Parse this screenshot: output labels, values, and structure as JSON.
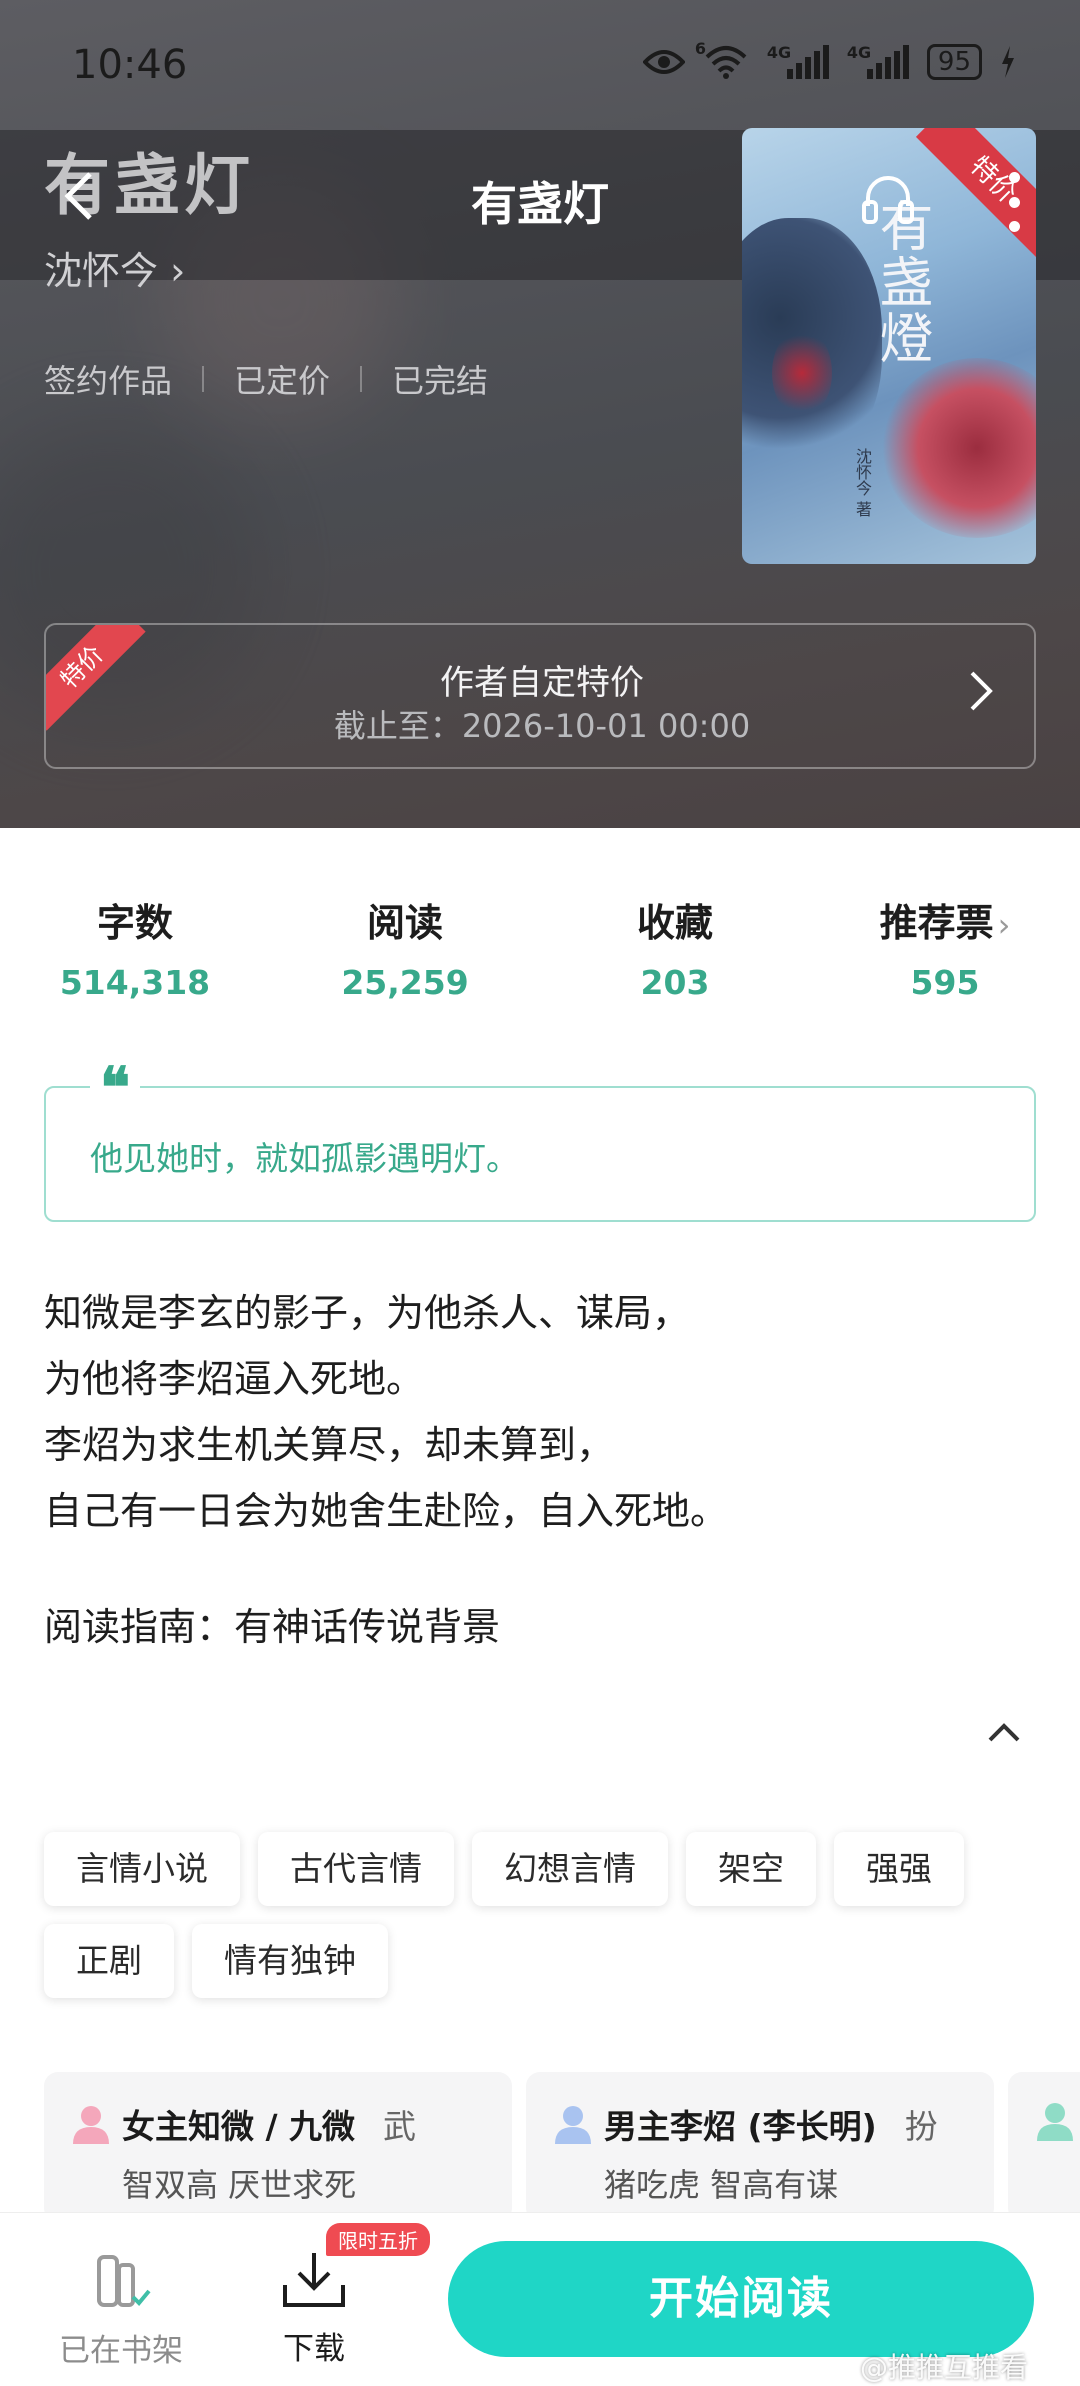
{
  "status_bar": {
    "time": "10:46",
    "signal1_label": "4G",
    "signal2_label": "4G",
    "wifi_label": "6",
    "battery": "95"
  },
  "header": {
    "background_title": "有盏灯",
    "nav_title": "有盏灯",
    "author": "沈怀今 ›"
  },
  "book_meta": {
    "items": [
      "签约作品",
      "已定价",
      "已完结"
    ]
  },
  "cover": {
    "ribbon": "特价",
    "title": "有盏燈",
    "author_mark": "沈怀今 著"
  },
  "promo": {
    "tag": "特价",
    "title": "作者自定特价",
    "deadline": "截止至：2026-10-01 00:00"
  },
  "stats": [
    {
      "label": "字数",
      "value": "514,318"
    },
    {
      "label": "阅读",
      "value": "25,259"
    },
    {
      "label": "收藏",
      "value": "203"
    },
    {
      "label": "推荐票",
      "value": "595"
    }
  ],
  "quote": {
    "mark": "“",
    "text": "他见她时，就如孤影遇明灯。"
  },
  "synopsis": {
    "lines": [
      "知微是李玄的影子，为他杀人、谋局，",
      "为他将李炤逼入死地。",
      "李炤为求生机关算尽，却未算到，",
      "自己有一日会为她舍生赴险，自入死地。"
    ],
    "guide": "阅读指南：有神话传说背景"
  },
  "tags": [
    "言情小说",
    "古代言情",
    "幻想言情",
    "架空",
    "强强",
    "正剧",
    "情有独钟"
  ],
  "characters": [
    {
      "name": "女主知微 / 九微",
      "extra": "武",
      "desc": "智双高 厌世求死",
      "icon_color": "#f4a7bb"
    },
    {
      "name": "男主李炤 (李长明)",
      "extra": "扮",
      "desc": "猪吃虎 智高有谋",
      "icon_color": "#a9c3f0"
    }
  ],
  "bottom_bar": {
    "shelf_label": "已在书架",
    "download_label": "下载",
    "download_badge": "限时五折",
    "read_button": "开始阅读"
  },
  "watermark": "@推推互推看",
  "colors": {
    "accent_green": "#38a98b",
    "read_button": "#1fd6c6",
    "sale_red": "#e2474f"
  }
}
